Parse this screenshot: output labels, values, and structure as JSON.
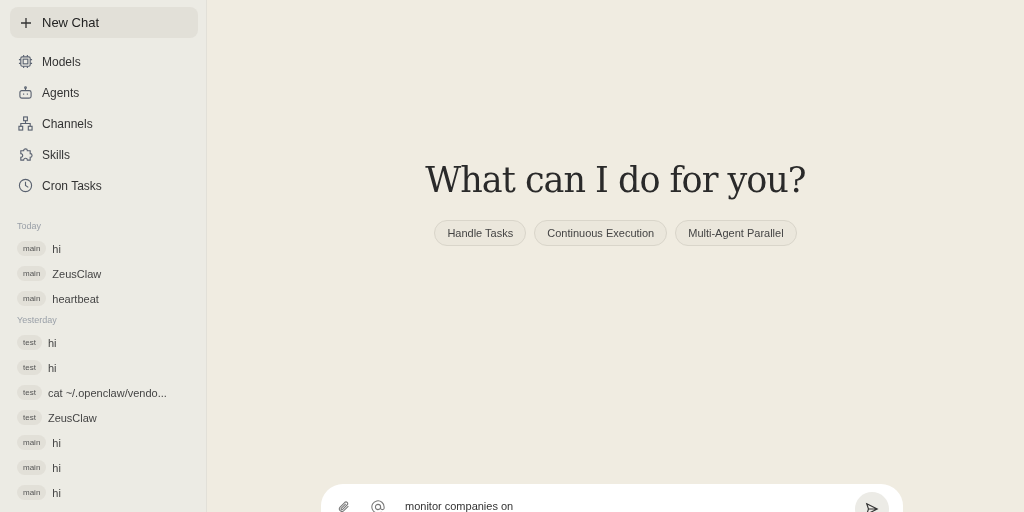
{
  "sidebar": {
    "new_chat": "New Chat",
    "nav": [
      {
        "kind": "models",
        "label": "Models"
      },
      {
        "kind": "agents",
        "label": "Agents"
      },
      {
        "kind": "channels",
        "label": "Channels"
      },
      {
        "kind": "skills",
        "label": "Skills"
      },
      {
        "kind": "cron",
        "label": "Cron Tasks"
      }
    ],
    "history": [
      {
        "heading": "Today",
        "items": [
          {
            "tag": "main",
            "title": "hi"
          },
          {
            "tag": "main",
            "title": "ZeusClaw"
          },
          {
            "tag": "main",
            "title": "heartbeat"
          }
        ]
      },
      {
        "heading": "Yesterday",
        "items": [
          {
            "tag": "test",
            "title": "hi"
          },
          {
            "tag": "test",
            "title": "hi"
          },
          {
            "tag": "test",
            "title": "cat ~/.openclaw/vendo..."
          },
          {
            "tag": "test",
            "title": "ZeusClaw"
          },
          {
            "tag": "main",
            "title": "hi"
          },
          {
            "tag": "main",
            "title": "hi"
          },
          {
            "tag": "main",
            "title": "hi"
          }
        ]
      }
    ]
  },
  "main": {
    "heading": "What can I do for you?",
    "suggestions": [
      "Handle Tasks",
      "Continuous Execution",
      "Multi-Agent Parallel"
    ],
    "composer": {
      "value": "monitor companies on"
    }
  }
}
